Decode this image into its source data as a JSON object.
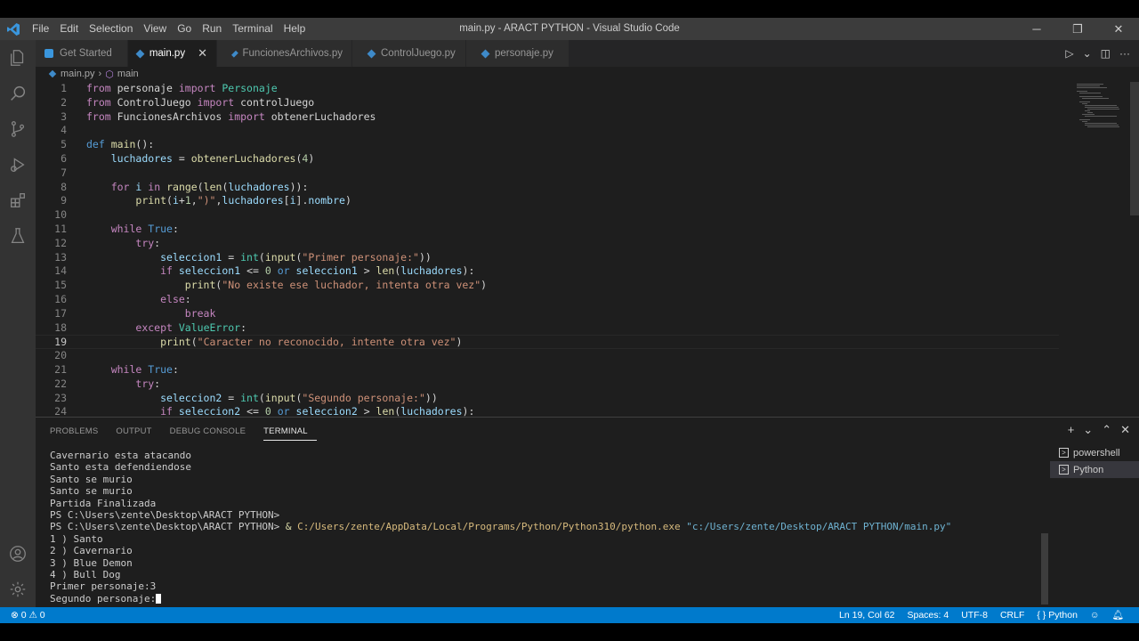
{
  "window": {
    "title": "main.py - ARACT PYTHON - Visual Studio Code",
    "menu": [
      "File",
      "Edit",
      "Selection",
      "View",
      "Go",
      "Run",
      "Terminal",
      "Help"
    ],
    "controls": {
      "minimize": "─",
      "restore": "❐",
      "close": "✕"
    }
  },
  "activity": [
    "explorer-icon",
    "search-icon",
    "source-control-icon",
    "run-debug-icon",
    "extensions-icon",
    "testing-icon",
    "account-icon",
    "settings-gear-icon"
  ],
  "tabs": [
    {
      "label": "Get Started",
      "icon_color": "#3a96dd"
    },
    {
      "label": "main.py",
      "icon_color": "#3e8ac9",
      "close": "✕"
    },
    {
      "label": "FuncionesArchivos.py",
      "icon_color": "#3e8ac9"
    },
    {
      "label": "ControlJuego.py",
      "icon_color": "#3e8ac9"
    },
    {
      "label": "personaje.py",
      "icon_color": "#3e8ac9"
    }
  ],
  "breadcrumb": {
    "file": "main.py",
    "sep": "›",
    "symbol": "main"
  },
  "editor": {
    "current_line": 19,
    "line_numbers": [
      "1",
      "2",
      "3",
      "4",
      "5",
      "6",
      "7",
      "8",
      "9",
      "10",
      "11",
      "12",
      "13",
      "14",
      "15",
      "16",
      "17",
      "18",
      "19",
      "20",
      "21",
      "22",
      "23",
      "24"
    ]
  },
  "panel": {
    "tabs": [
      "PROBLEMS",
      "OUTPUT",
      "DEBUG CONSOLE",
      "TERMINAL"
    ],
    "active_tab": "TERMINAL",
    "actions": {
      "add": "+",
      "dropdown": "⌄",
      "maximize": "⌃",
      "close": "✕"
    },
    "terminals": [
      "powershell",
      "Python"
    ],
    "output": [
      "Cavernario esta atacando",
      "Santo esta defendiendose",
      "Santo se murio",
      "Santo se murio",
      "Partida Finalizada",
      "PS C:\\Users\\zente\\Desktop\\ARACT PYTHON>"
    ],
    "command": {
      "prompt": "PS C:\\Users\\zente\\Desktop\\ARACT PYTHON> ",
      "amp": "& ",
      "exe": "C:/Users/zente/AppData/Local/Programs/Python/Python310/python.exe",
      "arg": " \"c:/Users/zente/Desktop/ARACT PYTHON/main.py\""
    },
    "output2": [
      "1 ) Santo",
      "2 ) Cavernario",
      "3 ) Blue Demon",
      "4 ) Bull Dog",
      "Primer personaje:3"
    ],
    "input_prompt": "Segundo personaje:"
  },
  "statusbar": {
    "problems": "⊗ 0 ⚠ 0",
    "position": "Ln 19, Col 62",
    "spaces": "Spaces: 4",
    "encoding": "UTF-8",
    "eol": "CRLF",
    "language": "{ } Python"
  },
  "colors": {
    "accent": "#007acc",
    "editor_bg": "#1e1e1e",
    "activity_bg": "#333333",
    "titlebar_bg": "#3c3c3c"
  }
}
